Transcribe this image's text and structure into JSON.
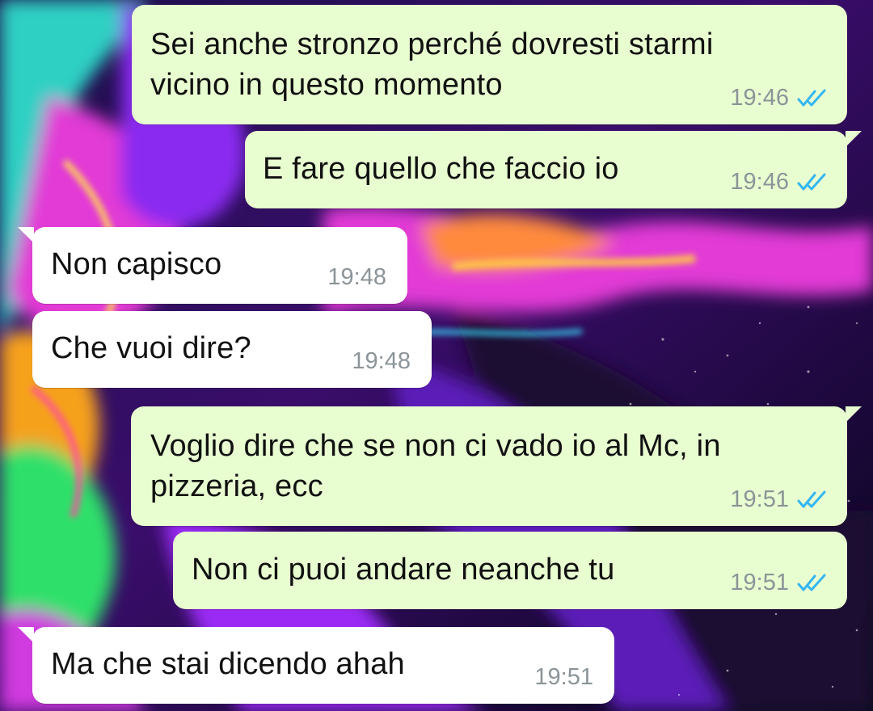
{
  "colors": {
    "outgoing_bubble": "#e8fdd0",
    "incoming_bubble": "#ffffff",
    "read_ticks": "#34b7f1",
    "timestamp": "#8b9498"
  },
  "icons": {
    "read_receipt": "double-check-icon"
  },
  "messages": [
    {
      "direction": "outgoing",
      "text": "Sei anche stronzo perché dovresti starmi\nvicino in questo momento",
      "time": "19:46",
      "status": "read"
    },
    {
      "direction": "outgoing",
      "text": "E fare quello che faccio io",
      "time": "19:46",
      "status": "read"
    },
    {
      "direction": "incoming",
      "text": "Non capisco",
      "time": "19:48"
    },
    {
      "direction": "incoming",
      "text": "Che vuoi dire?",
      "time": "19:48"
    },
    {
      "direction": "outgoing",
      "text": "Voglio dire che se non ci vado io al Mc, in\npizzeria, ecc",
      "time": "19:51",
      "status": "read"
    },
    {
      "direction": "outgoing",
      "text": "Non ci puoi andare neanche tu",
      "time": "19:51",
      "status": "read"
    },
    {
      "direction": "incoming",
      "text": "Ma che stai dicendo ahah",
      "time": "19:51"
    }
  ]
}
